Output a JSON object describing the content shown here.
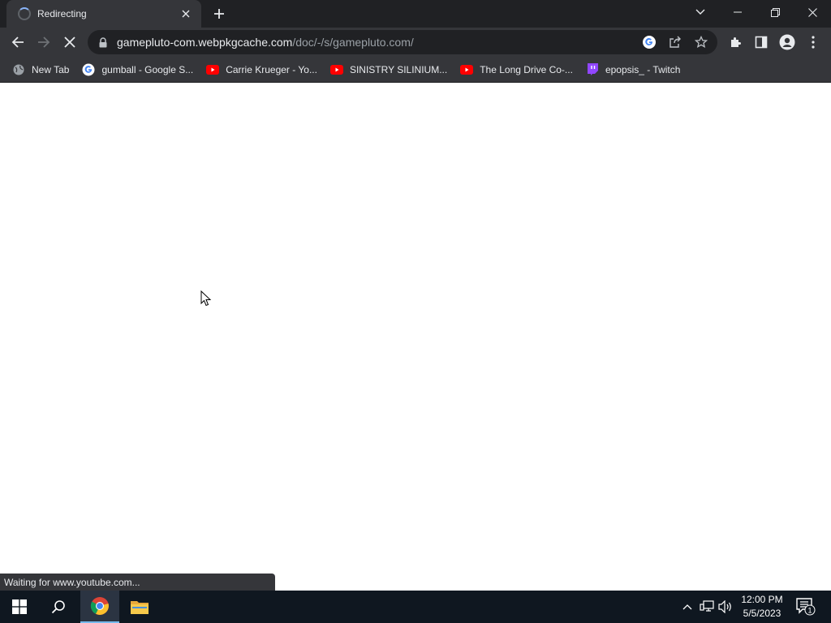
{
  "tab": {
    "title": "Redirecting"
  },
  "address_bar": {
    "url_host": "gamepluto-com.webpkgcache.com",
    "url_path": "/doc/-/s/gamepluto.com/"
  },
  "bookmarks": [
    {
      "label": "New Tab",
      "icon": "globe-icon"
    },
    {
      "label": "gumball - Google S...",
      "icon": "google-icon"
    },
    {
      "label": "Carrie Krueger - Yo...",
      "icon": "youtube-icon"
    },
    {
      "label": "SINISTRY SILINIUM...",
      "icon": "youtube-icon"
    },
    {
      "label": "The Long Drive Co-...",
      "icon": "youtube-icon"
    },
    {
      "label": "epopsis_ - Twitch",
      "icon": "twitch-icon"
    }
  ],
  "status": {
    "text": "Waiting for www.youtube.com..."
  },
  "taskbar": {
    "time": "12:00 PM",
    "date": "5/5/2023",
    "notification_count": "1"
  },
  "colors": {
    "youtube": "#ff0000",
    "twitch": "#9146ff",
    "accent": "#8ab4f8"
  }
}
